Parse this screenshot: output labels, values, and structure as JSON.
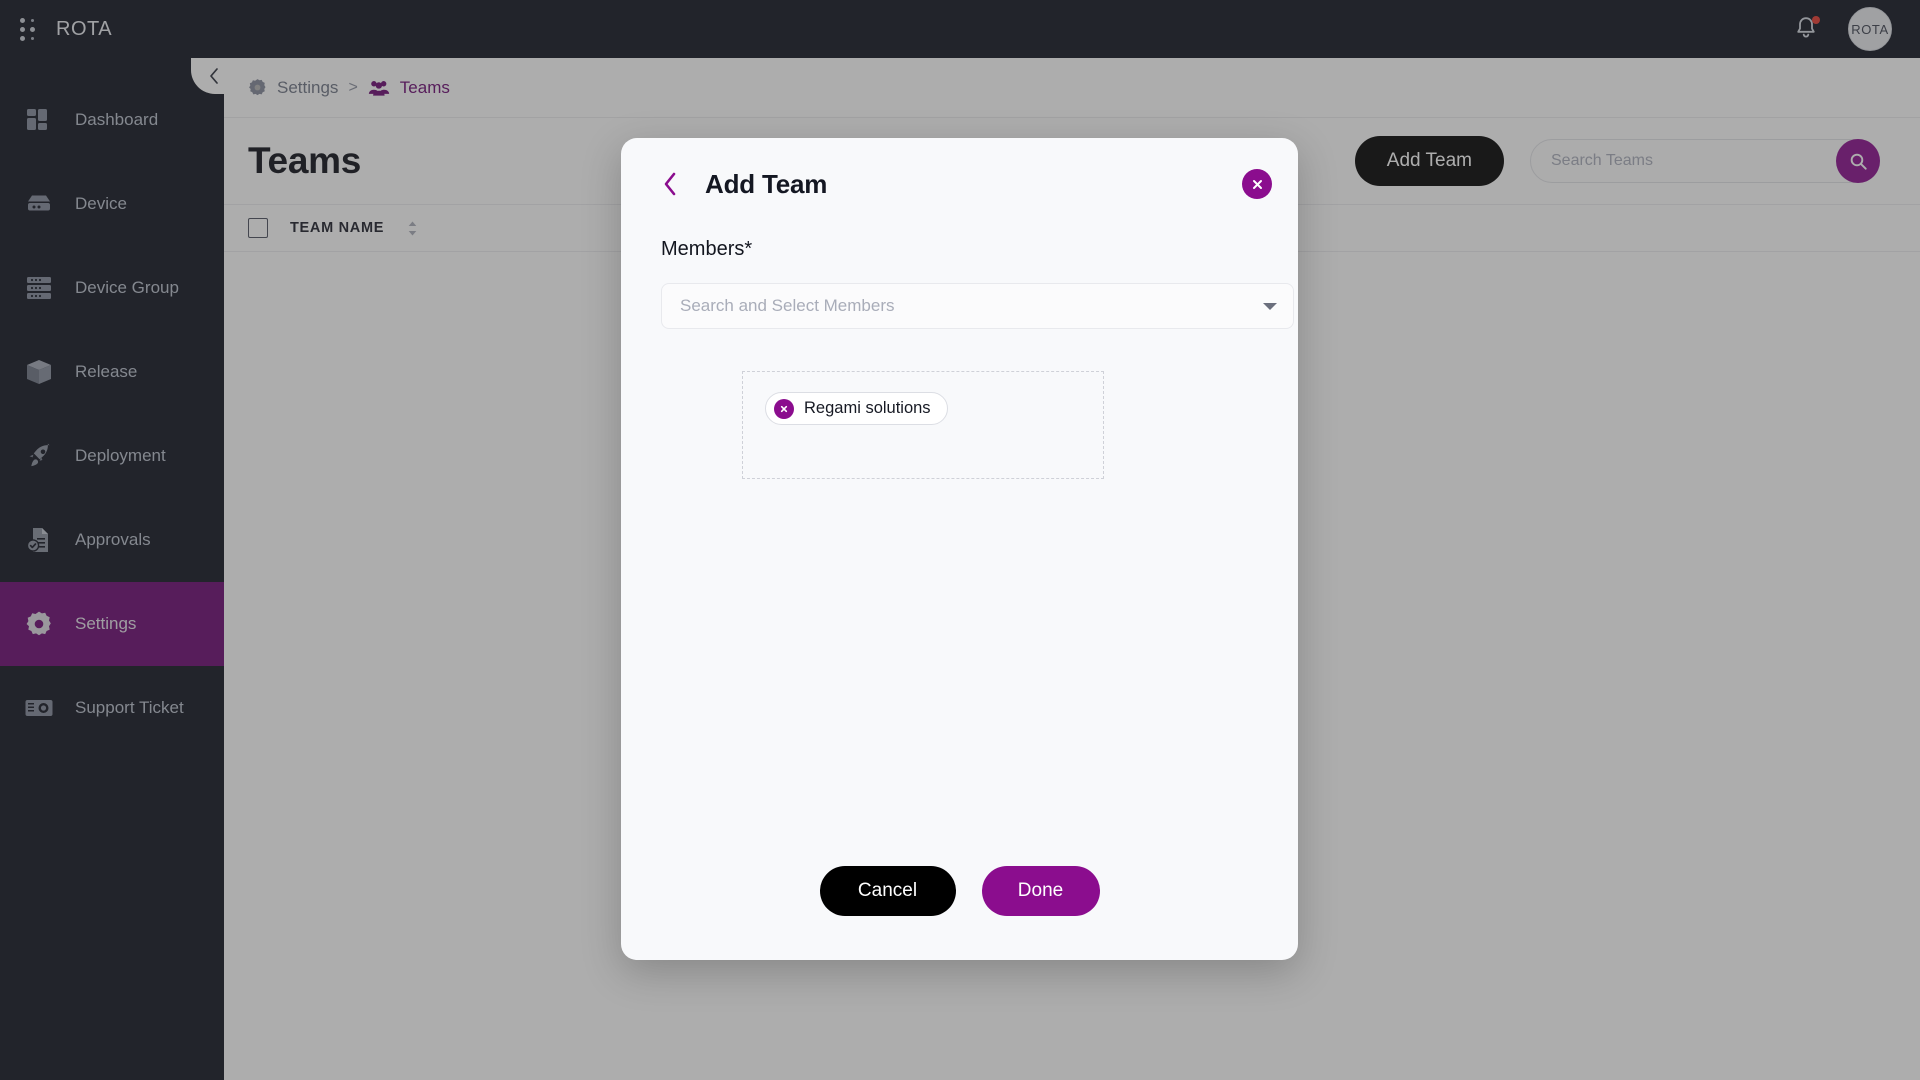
{
  "brand": {
    "name": "ROTA",
    "logo_icon": "dot-grid-icon"
  },
  "topbar": {
    "notification_icon": "bell-icon",
    "has_notification_badge": true,
    "avatar_text": "ROTA"
  },
  "sidebar": {
    "items": [
      {
        "label": "Dashboard",
        "icon": "dashboard-icon",
        "active": false
      },
      {
        "label": "Device",
        "icon": "device-icon",
        "active": false
      },
      {
        "label": "Device Group",
        "icon": "device-group-icon",
        "active": false
      },
      {
        "label": "Release",
        "icon": "release-box-icon",
        "active": false
      },
      {
        "label": "Deployment",
        "icon": "rocket-icon",
        "active": false
      },
      {
        "label": "Approvals",
        "icon": "approvals-icon",
        "active": false
      },
      {
        "label": "Settings",
        "icon": "gear-icon",
        "active": true
      },
      {
        "label": "Support Ticket",
        "icon": "support-ticket-icon",
        "active": false
      }
    ],
    "active_bg": "#6b0772"
  },
  "breadcrumb": {
    "items": [
      {
        "label": "Settings",
        "icon": "gear-icon",
        "current": false
      },
      {
        "label": "Teams",
        "icon": "teams-icon",
        "current": true
      }
    ],
    "separator": ">"
  },
  "page": {
    "title": "Teams",
    "add_team_label": "Add Team",
    "search": {
      "placeholder": "Search Teams",
      "value": "",
      "button_icon": "search-icon"
    },
    "table": {
      "columns": [
        "TEAM NAME"
      ],
      "sort_icon": "sort-arrows-icon",
      "rows": []
    },
    "collapse_icon": "chevron-left-icon"
  },
  "modal": {
    "title": "Add Team",
    "back_icon": "chevron-left-icon",
    "close_icon": "close-x-icon",
    "members_label": "Members*",
    "members_select": {
      "placeholder": "Search and Select Members",
      "value": "",
      "caret_icon": "chevron-down-icon"
    },
    "selected_members": [
      {
        "label": "Regami solutions",
        "remove_icon": "close-x-icon"
      }
    ],
    "cancel_label": "Cancel",
    "done_label": "Done"
  },
  "colors": {
    "brand_purple": "#8b0d8e",
    "sidebar_active": "#6b0772",
    "sidebar_bg": "#10131f",
    "black_button": "#000000",
    "notification_red": "#e8392f"
  }
}
